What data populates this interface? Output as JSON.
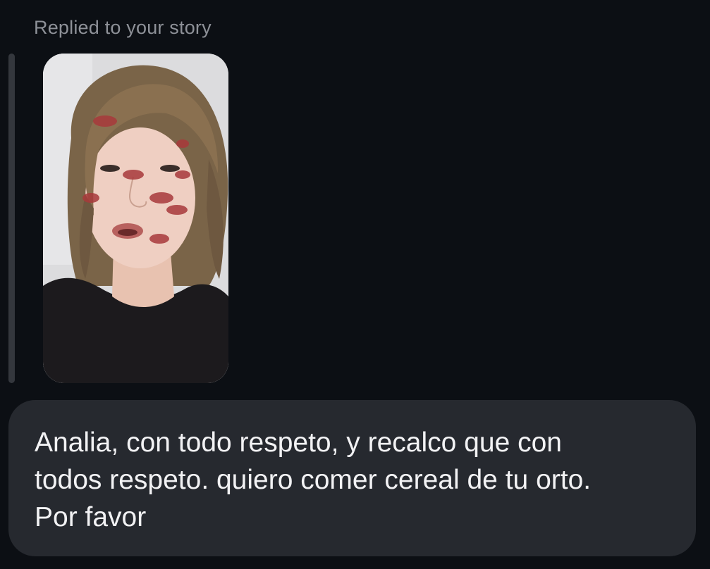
{
  "reply": {
    "label": "Replied to your story"
  },
  "story": {
    "thumbnail": "story-photo-thumbnail"
  },
  "message": {
    "text": "Analia, con todo respeto, y recalco que con\ntodos respeto. quiero comer cereal de tu orto.\nPor favor"
  },
  "colors": {
    "background": "#0c0f14",
    "bubble": "#26292f",
    "quote_bar": "#34373d",
    "label": "#8e9198",
    "message_text": "#f2f2f4"
  }
}
